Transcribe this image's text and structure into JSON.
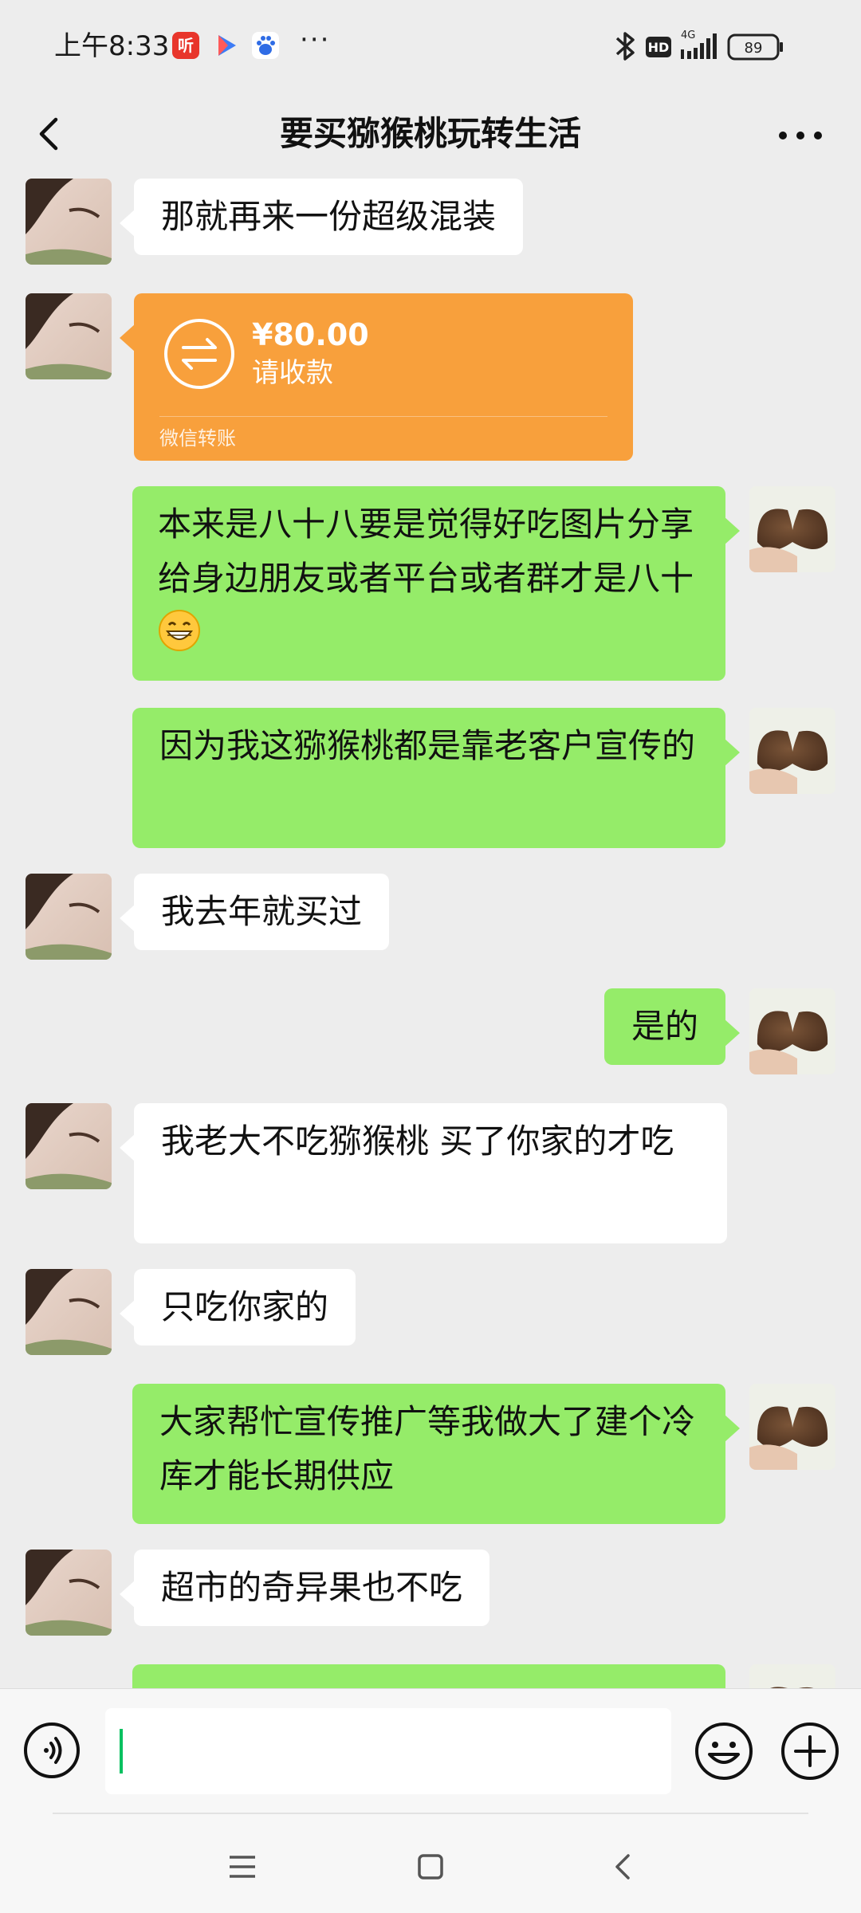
{
  "status_bar": {
    "time": "上午8:33",
    "ting_icon_text": "听",
    "overflow": "···",
    "network": "4G",
    "hd": "HD",
    "battery": "89"
  },
  "header": {
    "title": "要买猕猴桃玩转生活"
  },
  "messages": [
    {
      "side": "in",
      "text": "那就再来一份超级混装"
    },
    {
      "side": "in",
      "type": "transfer",
      "amount": "¥80.00",
      "label": "请收款",
      "footer": "微信转账",
      "color": "#f8a03c"
    },
    {
      "side": "out",
      "text": "本来是八十八要是觉得好吃图片分享给身边朋友或者平台或者群才是八十",
      "emoji": "grinning-face"
    },
    {
      "side": "out",
      "text": "因为我这猕猴桃都是靠老客户宣传的"
    },
    {
      "side": "in",
      "text": "我去年就买过"
    },
    {
      "side": "out",
      "text": "是的"
    },
    {
      "side": "in",
      "text": "我老大不吃猕猴桃 买了你家的才吃"
    },
    {
      "side": "in",
      "text": "只吃你家的"
    },
    {
      "side": "out",
      "text": "大家帮忙宣传推广等我做大了建个冷库才能长期供应"
    },
    {
      "side": "in",
      "text": "超市的奇异果也不吃"
    },
    {
      "side": "out",
      "text": ""
    }
  ],
  "colors": {
    "background": "#ededed",
    "incoming_bubble": "#ffffff",
    "outgoing_bubble": "#95ec69",
    "transfer_card": "#f8a03c",
    "caret": "#07c160"
  },
  "input": {
    "value": ""
  },
  "icons": [
    "back-arrow-icon",
    "more-icon",
    "voice-icon",
    "emoji-icon",
    "plus-icon",
    "bluetooth-icon",
    "signal-icon",
    "battery-icon",
    "transfer-arrows-icon",
    "menu-icon",
    "home-icon",
    "back-nav-icon"
  ]
}
